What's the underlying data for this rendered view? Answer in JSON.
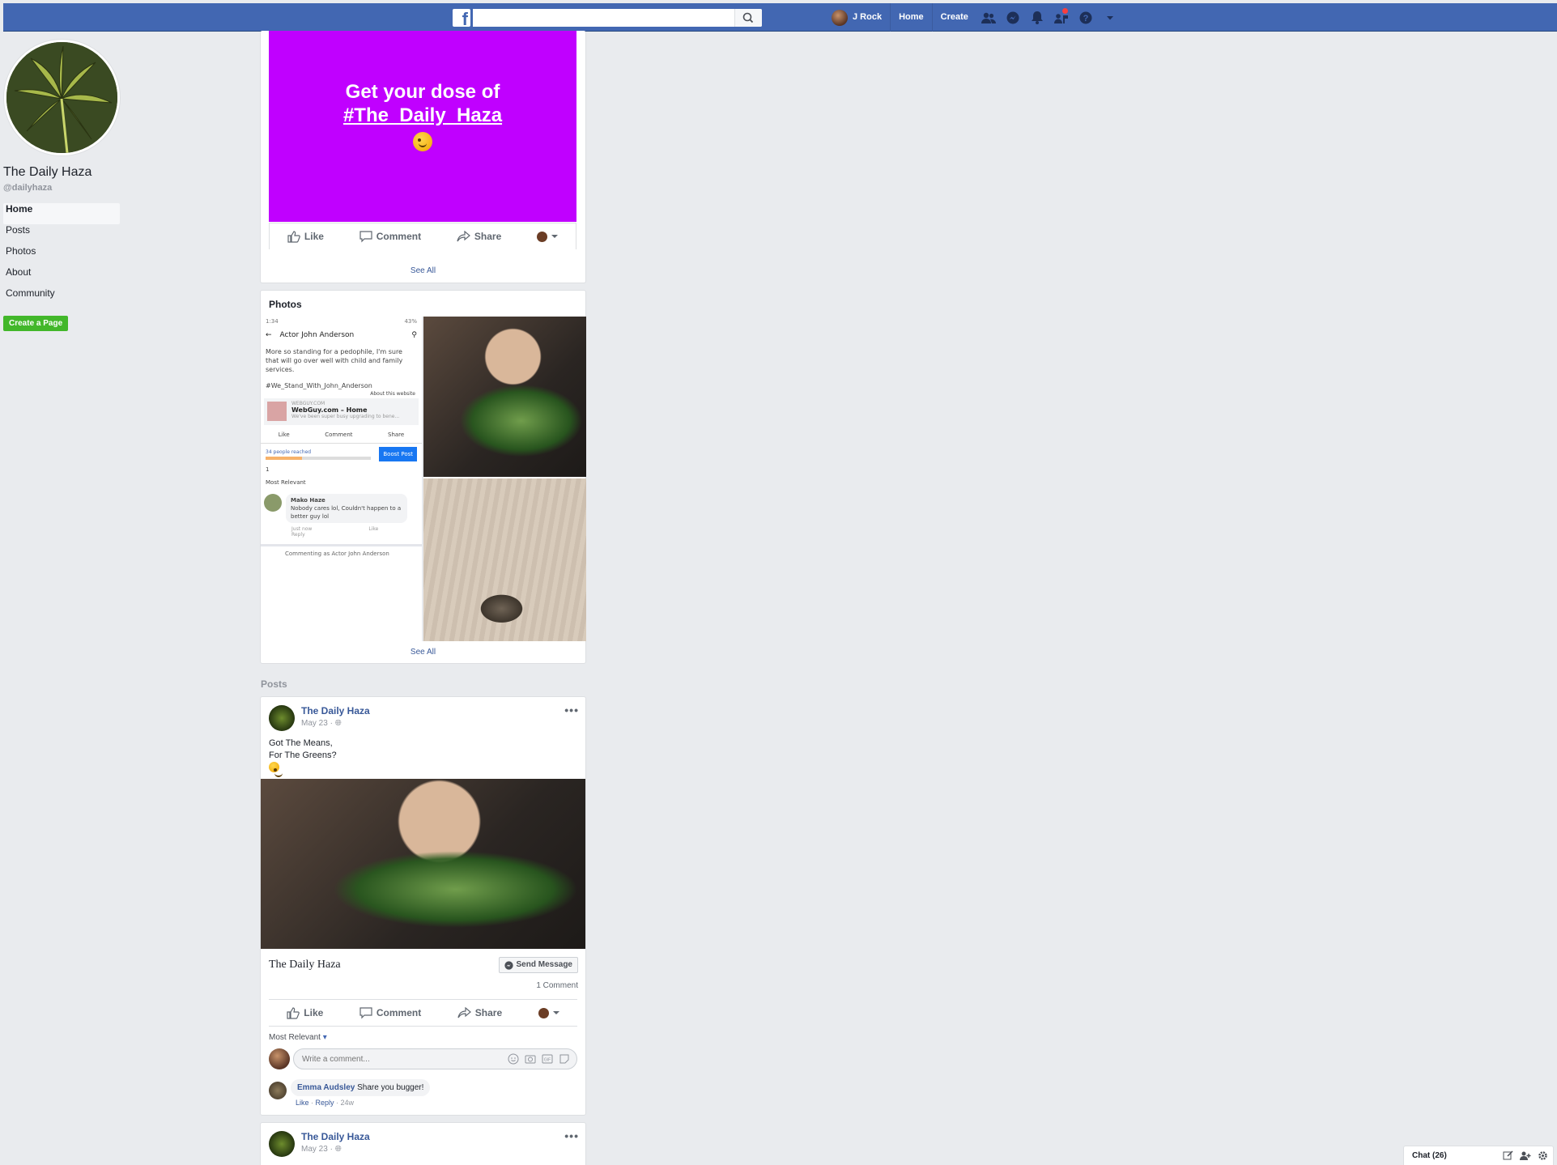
{
  "header": {
    "search_placeholder": "",
    "user_name": "J Rock",
    "home_label": "Home",
    "create_label": "Create"
  },
  "sidebar": {
    "page_name": "The Daily Haza",
    "handle": "@dailyhaza",
    "items": [
      {
        "label": "Home"
      },
      {
        "label": "Posts"
      },
      {
        "label": "Photos"
      },
      {
        "label": "About"
      },
      {
        "label": "Community"
      }
    ],
    "create_page_label": "Create a Page"
  },
  "promo_card": {
    "line1": "Get your dose of",
    "line2": "#The_Daily_Haza",
    "like": "Like",
    "comment": "Comment",
    "share": "Share",
    "see_all": "See All"
  },
  "photos_card": {
    "title": "Photos",
    "see_all": "See All",
    "screenshot": {
      "status": "1:34",
      "battery": "43%",
      "page_title": "Actor John Anderson",
      "post_text": "More so standing for a pedophile, I'm sure that will go over well with child and family services.",
      "hashtag": "#We_Stand_With_John_Anderson",
      "about_website": "About this website",
      "link_domain": "WEBGUY.COM",
      "link_title": "WebGuy.com – Home",
      "link_desc": "We've been super busy upgrading to bene...",
      "like": "Like",
      "comment": "Comment",
      "share": "Share",
      "reached": "34 people reached",
      "boost": "Boost Post",
      "reaction_count": "1",
      "most_relevant": "Most Relevant",
      "commenter": "Mako Haze",
      "comment_text": "Nobody cares lol, Couldn't happen to a better guy lol",
      "comment_time": "Just now",
      "comment_like": "Like",
      "comment_reply": "Reply",
      "commenting_as": "Commenting as Actor John Anderson"
    }
  },
  "posts_section": {
    "heading": "Posts"
  },
  "post1": {
    "author": "The Daily Haza",
    "date": "May 23 ·",
    "text1": "Got The Means,",
    "text2": "For The Greens?",
    "link_title": "The Daily Haza",
    "send_message": "Send Message",
    "comment_count": "1 Comment",
    "like": "Like",
    "comment": "Comment",
    "share": "Share",
    "most_relevant": "Most Relevant",
    "comment_placeholder": "Write a comment...",
    "commenter": "Emma Audsley",
    "comment_text": "Share you bugger!",
    "comment_like": "Like",
    "comment_reply": "Reply",
    "comment_time": "24w"
  },
  "post2": {
    "author": "The Daily Haza",
    "date": "May 23 ·"
  },
  "chat": {
    "label": "Chat (26)"
  },
  "colors": {
    "brand_blue": "#4267b2",
    "promo_purple": "#c000ff",
    "create_green": "#42b72a",
    "link_blue": "#385898"
  }
}
